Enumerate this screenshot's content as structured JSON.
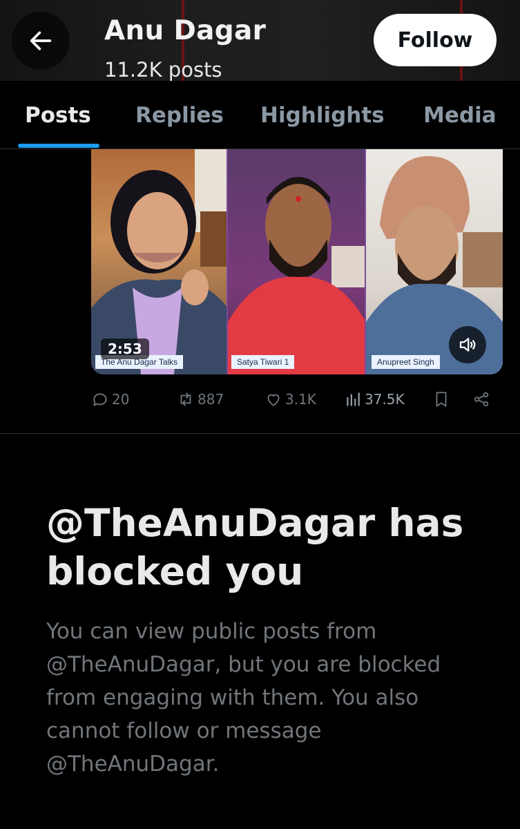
{
  "header": {
    "back_icon": "arrow-left-icon",
    "name": "Anu Dagar",
    "post_count": "11.2K posts",
    "follow_label": "Follow"
  },
  "tabs": [
    {
      "label": "Posts",
      "active": true
    },
    {
      "label": "Replies",
      "active": false
    },
    {
      "label": "Highlights",
      "active": false
    },
    {
      "label": "Media",
      "active": false
    }
  ],
  "media": {
    "duration": "2:53",
    "participants": [
      {
        "label": "The Anu Dagar Talks"
      },
      {
        "label": "Satya Tiwari 1"
      },
      {
        "label": "Anupreet Singh"
      }
    ],
    "sound_icon": "speaker-icon"
  },
  "actions": {
    "replies": "20",
    "reposts": "887",
    "likes": "3.1K",
    "views": "37.5K",
    "bookmark_icon": "bookmark-icon",
    "share_icon": "share-icon"
  },
  "block_notice": {
    "title": "@TheAnuDagar has blocked you",
    "body": "You can view public posts from @TheAnuDagar, but you are blocked from engaging with them. You also cannot follow or message @TheAnuDagar."
  },
  "colors": {
    "accent": "#1d9bf0",
    "background": "#000000",
    "muted_text": "#71767b"
  }
}
